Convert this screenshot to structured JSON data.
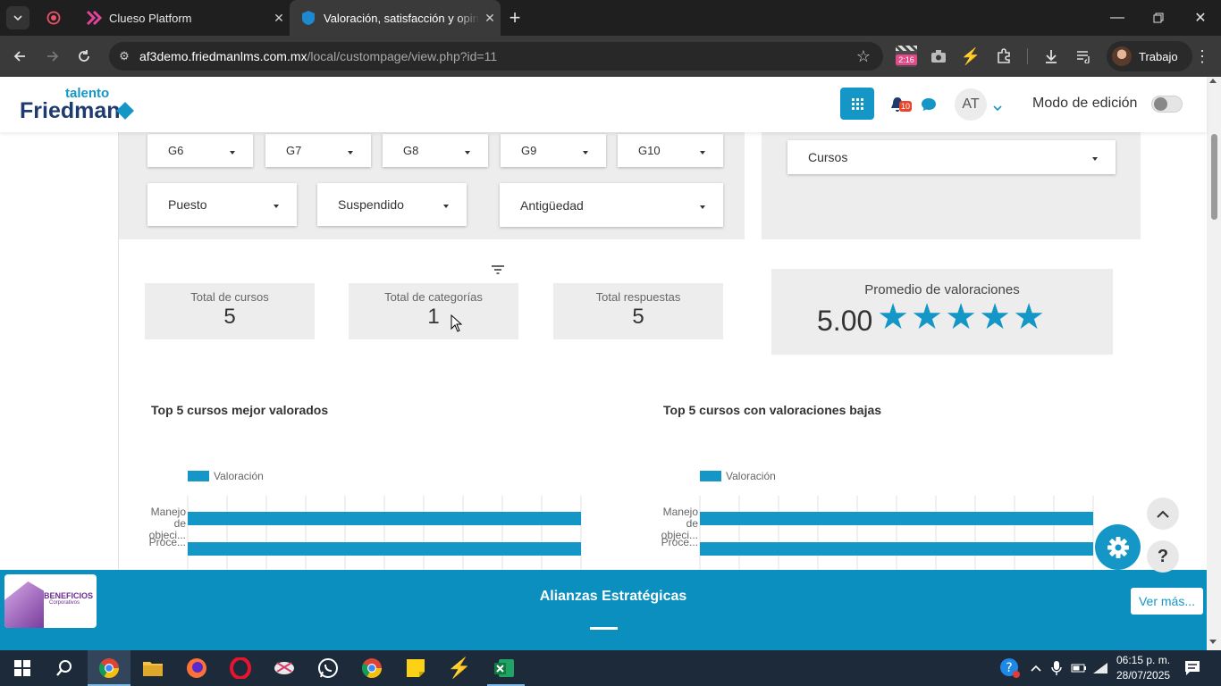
{
  "browser": {
    "tabs": [
      {
        "title": "Clueso Platform"
      },
      {
        "title": "Valoración, satisfacción y opinión"
      }
    ],
    "url_domain": "af3demo.friedmanlms.com.mx",
    "url_path": "/local/custompage/view.php?id=11",
    "ext_badge": "2:16",
    "profile_name": "Trabajo"
  },
  "site": {
    "logo_top": "talento",
    "logo_main": "Friedman",
    "notif_count": "10",
    "user_initials": "AT",
    "edit_mode_label": "Modo de edición"
  },
  "filters": {
    "row1": [
      "G6",
      "G7",
      "G8",
      "G9",
      "G10"
    ],
    "puesto": "Puesto",
    "suspendido": "Suspendido",
    "antiguedad": "Antigüedad",
    "cursos": "Cursos"
  },
  "kpis": {
    "total_cursos_label": "Total de cursos",
    "total_cursos_value": "5",
    "total_categorias_label": "Total de categorías",
    "total_categorias_value": "1",
    "total_respuestas_label": "Total respuestas",
    "total_respuestas_value": "5",
    "promedio_label": "Promedio de valoraciones",
    "promedio_value": "5.00",
    "stars": 5
  },
  "chart_data": [
    {
      "type": "bar",
      "orientation": "horizontal",
      "title": "Top 5 cursos mejor valorados",
      "categories": [
        "Manejo de objeci...",
        "Proce..."
      ],
      "series": [
        {
          "name": "Valoración",
          "values": [
            5,
            5
          ]
        }
      ],
      "xlim": [
        0,
        5
      ],
      "grid": true,
      "legend": "top-left",
      "color": "#1497c6"
    },
    {
      "type": "bar",
      "orientation": "horizontal",
      "title": "Top 5 cursos con valoraciones bajas",
      "categories": [
        "Manejo de objeci...",
        "Proce..."
      ],
      "series": [
        {
          "name": "Valoración",
          "values": [
            5,
            5
          ]
        }
      ],
      "xlim": [
        0,
        5
      ],
      "grid": true,
      "legend": "top-left",
      "color": "#1497c6"
    }
  ],
  "footer": {
    "title": "Alianzas Estratégicas",
    "more_label": "Ver más...",
    "banner_title": "BENEFICIOS",
    "banner_sub": "Corporativos"
  },
  "taskbar": {
    "time": "06:15 p. m.",
    "date": "28/07/2025"
  },
  "colors": {
    "accent": "#1497c6",
    "footer": "#0a8fbf",
    "brand_dark": "#1e3a6e"
  }
}
